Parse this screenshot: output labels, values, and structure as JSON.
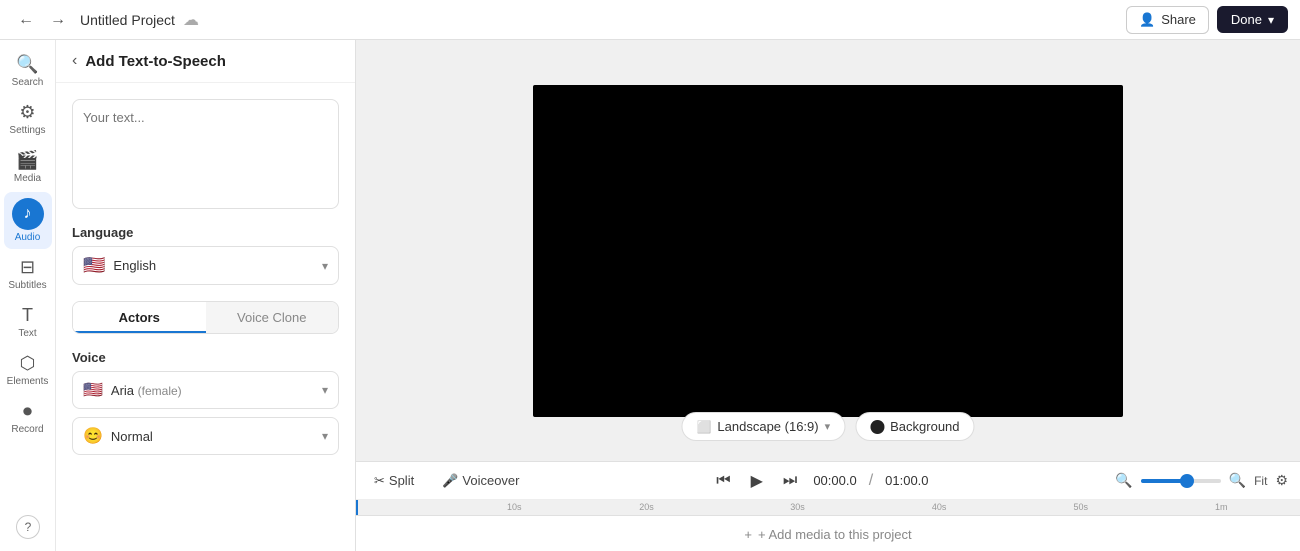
{
  "topbar": {
    "title": "Untitled Project",
    "cloud_icon": "☁",
    "share_label": "Share",
    "share_icon": "👤",
    "done_label": "Done",
    "chevron": "▾",
    "nav_back": "←",
    "nav_forward": "→"
  },
  "sidebar": {
    "items": [
      {
        "id": "search",
        "icon": "🔍",
        "label": "Search"
      },
      {
        "id": "settings",
        "icon": "⚙",
        "label": "Settings"
      },
      {
        "id": "media",
        "icon": "🎬",
        "label": "Media"
      },
      {
        "id": "audio",
        "icon": "♪",
        "label": "Audio",
        "active": true
      },
      {
        "id": "subtitles",
        "icon": "⊟",
        "label": "Subtitles"
      },
      {
        "id": "text",
        "icon": "T",
        "label": "Text"
      },
      {
        "id": "elements",
        "icon": "⬡",
        "label": "Elements"
      },
      {
        "id": "record",
        "icon": "⏺",
        "label": "Record"
      }
    ]
  },
  "panel": {
    "back_icon": "‹",
    "title": "Add Text-to-Speech",
    "textarea_placeholder": "Your text...",
    "language_section_label": "Language",
    "language_flag": "🇺🇸",
    "language_name": "English",
    "tabs": [
      {
        "id": "actors",
        "label": "Actors",
        "active": true
      },
      {
        "id": "voice_clone",
        "label": "Voice Clone",
        "active": false
      }
    ],
    "voice_section_label": "Voice",
    "voice_flag": "🇺🇸",
    "voice_name": "Aria",
    "voice_gender": "(female)",
    "voice_style_emoji": "😊",
    "voice_style": "Normal",
    "chevron": "▾"
  },
  "canvas": {
    "landscape_label": "Landscape (16:9)",
    "landscape_icon": "⬜",
    "background_label": "Background",
    "chevron": "▾"
  },
  "timeline": {
    "split_label": "Split",
    "split_icon": "✂",
    "voiceover_label": "Voiceover",
    "voiceover_icon": "🎤",
    "current_time": "00:00.0",
    "separator": "/",
    "total_time": "01:00.0",
    "zoom_fit": "Fit",
    "ruler_marks": [
      "10s",
      "20s",
      "30s",
      "40s",
      "50s",
      "1m"
    ],
    "add_media_label": "+ Add media to this project"
  },
  "help": {
    "icon": "?"
  }
}
